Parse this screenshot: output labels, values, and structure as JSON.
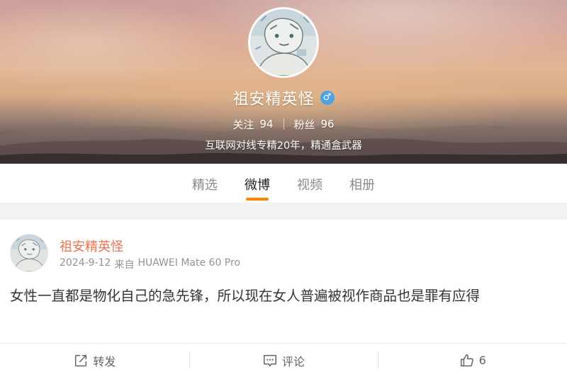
{
  "profile": {
    "name": "祖安精英怪",
    "gender_symbol": "♂",
    "following_label": "关注",
    "following_count": "94",
    "followers_label": "粉丝",
    "followers_count": "96",
    "bio": "互联网对线专精20年，精通盒武器"
  },
  "tabs": [
    {
      "label": "精选",
      "active": false
    },
    {
      "label": "微博",
      "active": true
    },
    {
      "label": "视频",
      "active": false
    },
    {
      "label": "相册",
      "active": false
    }
  ],
  "post": {
    "author": "祖安精英怪",
    "date": "2024-9-12",
    "source_prefix": "来自",
    "device": "HUAWEI Mate 60 Pro",
    "text": "女性一直都是物化自己的急先锋，所以现在女人普遍被视作商品也是罪有应得",
    "actions": {
      "repost_label": "转发",
      "comment_label": "评论",
      "like_count": "6"
    }
  },
  "colors": {
    "accent": "#ff8200",
    "author_name": "#eb7350",
    "gender_badge": "#4ea3e6"
  },
  "icons": [
    "gender-male-icon",
    "repost-icon",
    "comment-icon",
    "like-icon"
  ]
}
